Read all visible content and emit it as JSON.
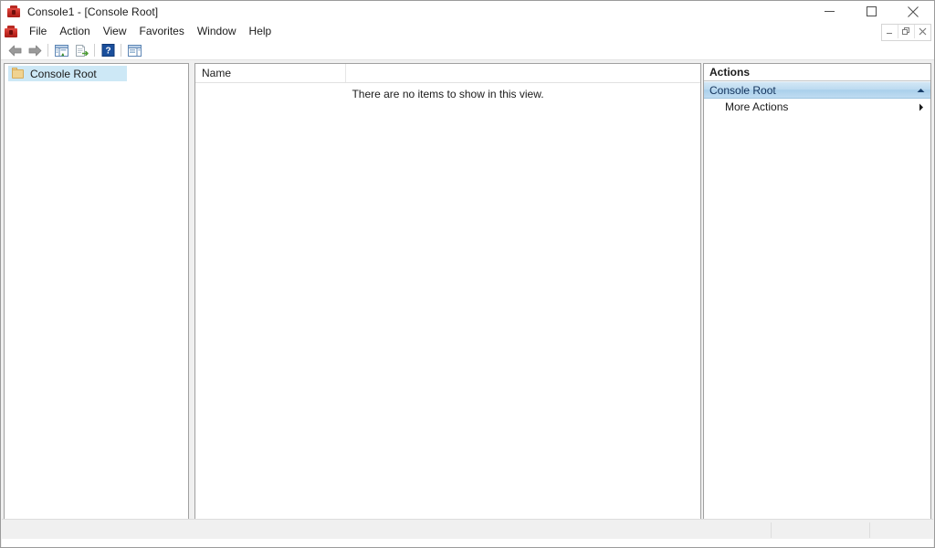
{
  "window": {
    "title": "Console1 - [Console Root]",
    "app_icon": "mmc-console-icon",
    "controls": {
      "minimize": "Minimize",
      "maximize": "Maximize",
      "close": "Close"
    },
    "mdi_controls": {
      "minimize": "Minimize Document",
      "restore": "Restore Document",
      "close": "Close Document"
    }
  },
  "menubar": {
    "icon": "mmc-console-icon",
    "items": [
      {
        "label": "File"
      },
      {
        "label": "Action"
      },
      {
        "label": "View"
      },
      {
        "label": "Favorites"
      },
      {
        "label": "Window"
      },
      {
        "label": "Help"
      }
    ]
  },
  "toolbar": {
    "buttons": [
      {
        "name": "back-button",
        "icon": "arrow-left-icon",
        "label": "Back"
      },
      {
        "name": "forward-button",
        "icon": "arrow-right-icon",
        "label": "Forward"
      },
      {
        "name": "show-hide-tree-button",
        "icon": "show-tree-icon",
        "label": "Show/Hide Console Tree"
      },
      {
        "name": "export-list-button",
        "icon": "export-list-icon",
        "label": "Export List"
      },
      {
        "name": "help-button",
        "icon": "question-mark-icon",
        "label": "Help"
      },
      {
        "name": "show-action-pane-button",
        "icon": "show-action-pane-icon",
        "label": "Show/Hide Action Pane"
      }
    ]
  },
  "tree": {
    "items": [
      {
        "label": "Console Root",
        "icon": "folder-icon",
        "selected": true
      }
    ]
  },
  "list": {
    "columns": [
      {
        "label": "Name"
      }
    ],
    "empty_message": "There are no items to show in this view.",
    "rows": []
  },
  "actions": {
    "title": "Actions",
    "groups": [
      {
        "label": "Console Root",
        "collapse_icon": "chevron-up-icon",
        "items": [
          {
            "label": "More Actions",
            "submenu_icon": "chevron-right-icon"
          }
        ]
      }
    ]
  },
  "statusbar": {
    "text": "",
    "segments": [
      "",
      "",
      ""
    ]
  },
  "background": {
    "ghost_text": ""
  },
  "colors": {
    "accent": "#a9cfeb",
    "selection": "#cde8f6",
    "window_bg": "#f0f0f0",
    "pane_border": "#a0a0a0",
    "text": "#1b1b1b",
    "icon_red": "#c32b24",
    "icon_blue": "#1a4f9c",
    "icon_green": "#5ba13c",
    "folder": "#f0d391"
  }
}
